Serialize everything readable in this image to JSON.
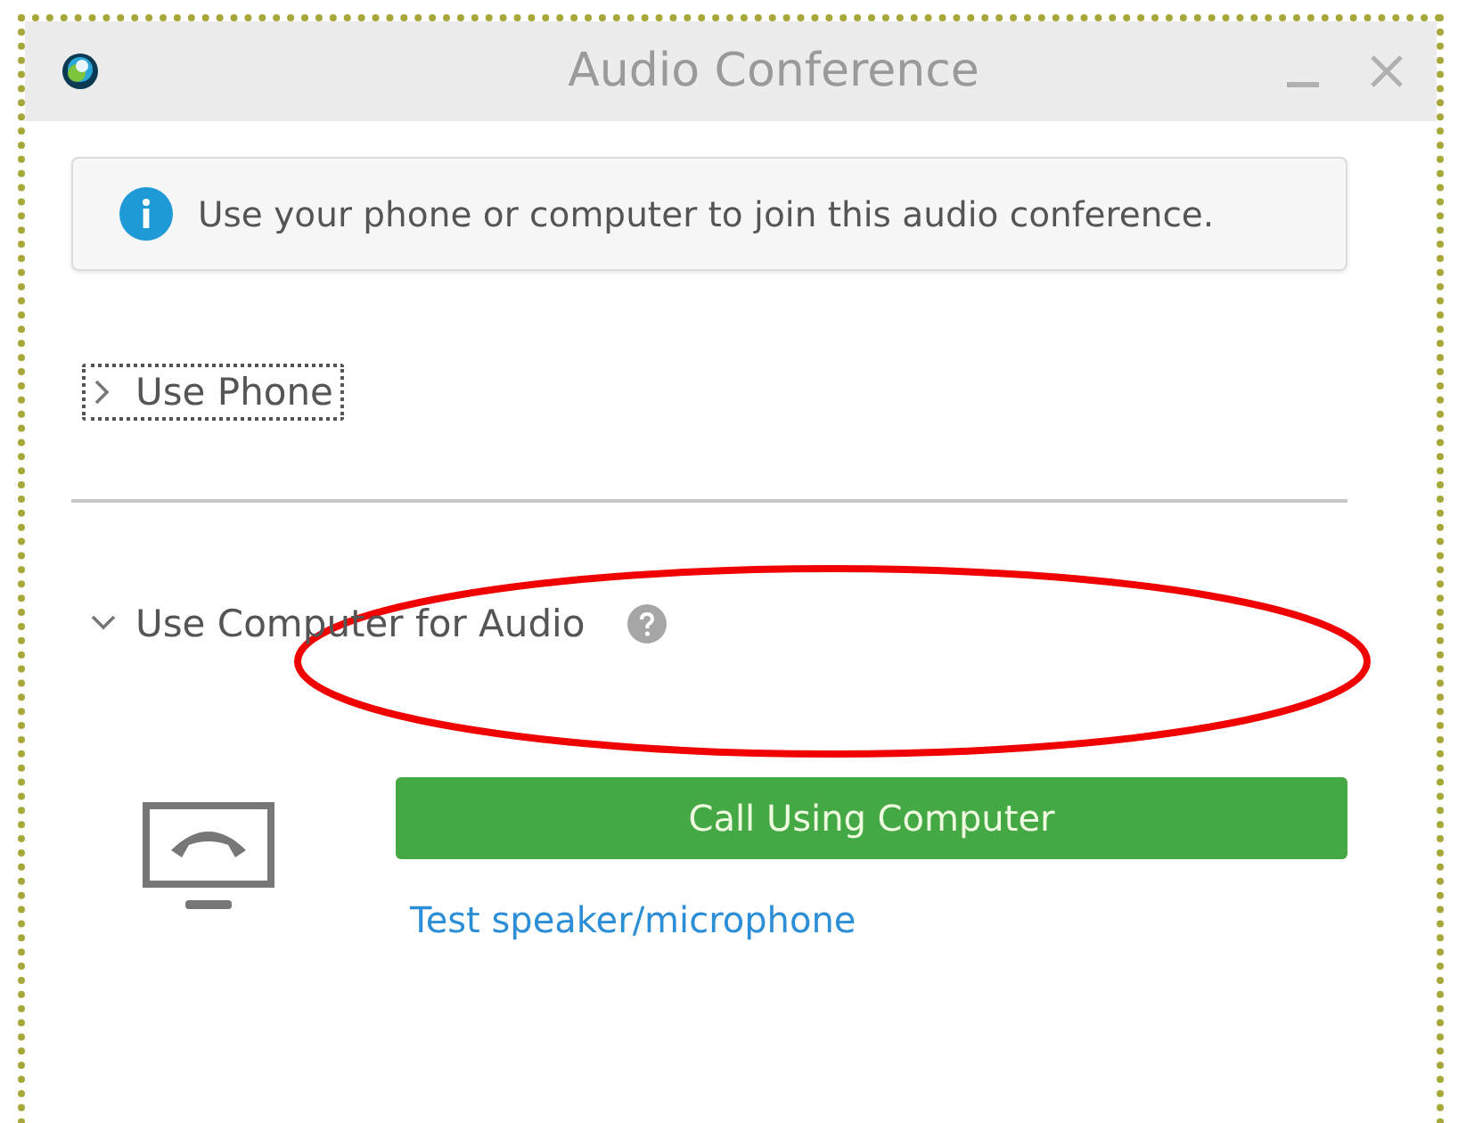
{
  "window": {
    "title": "Audio Conference"
  },
  "info": {
    "text": "Use your phone or computer to join this audio conference."
  },
  "sections": [
    {
      "label": "Use Phone",
      "expanded": false,
      "focused": true,
      "help": false
    },
    {
      "label": "Use Computer for Audio",
      "expanded": true,
      "focused": false,
      "help": true,
      "call_button": "Call Using Computer",
      "test_link": "Test speaker/microphone"
    }
  ]
}
